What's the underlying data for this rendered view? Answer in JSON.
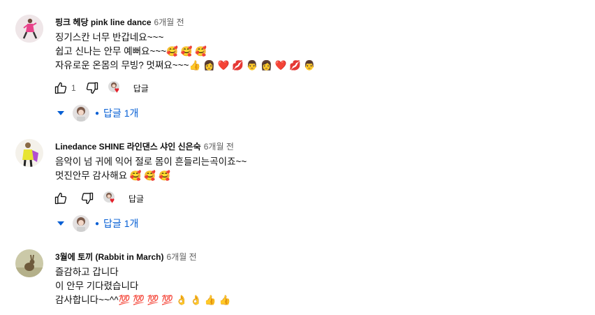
{
  "labels": {
    "reply": "답글"
  },
  "colors": {
    "heart": "#e4212b",
    "link": "#065fd4"
  },
  "comments": [
    {
      "author": "핑크 헤당 pink line dance",
      "time": "6개월 전",
      "lines": [
        "징기스칸 너무 반갑네요~~~",
        "쉽고 신나는 안무 예뻐요~~~🥰 🥰 🥰",
        "자유로운 온몸의 무빙? 멋쪄요~~~👍 👩 ❤️ 💋 👨 👩 ❤️ 💋 👨"
      ],
      "likes": "1",
      "replies": "답글 1개"
    },
    {
      "author": "Linedance SHINE 라인댄스 샤인 신은숙",
      "time": "6개월 전",
      "lines": [
        "음악이 넘 귀에 익어 절로 몸이 흔들리는곡이죠~~",
        "멋진안무 감사해요 🥰 🥰 🥰"
      ],
      "likes": "",
      "replies": "답글 1개"
    },
    {
      "author": "3월에 토끼 (Rabbit in March)",
      "time": "6개월 전",
      "lines": [
        "즐감하고 갑니다",
        "이 안무 기다렸습니다",
        "감사합니다~~^^💯 💯 💯 💯 👌 👌 👍 👍"
      ]
    }
  ]
}
